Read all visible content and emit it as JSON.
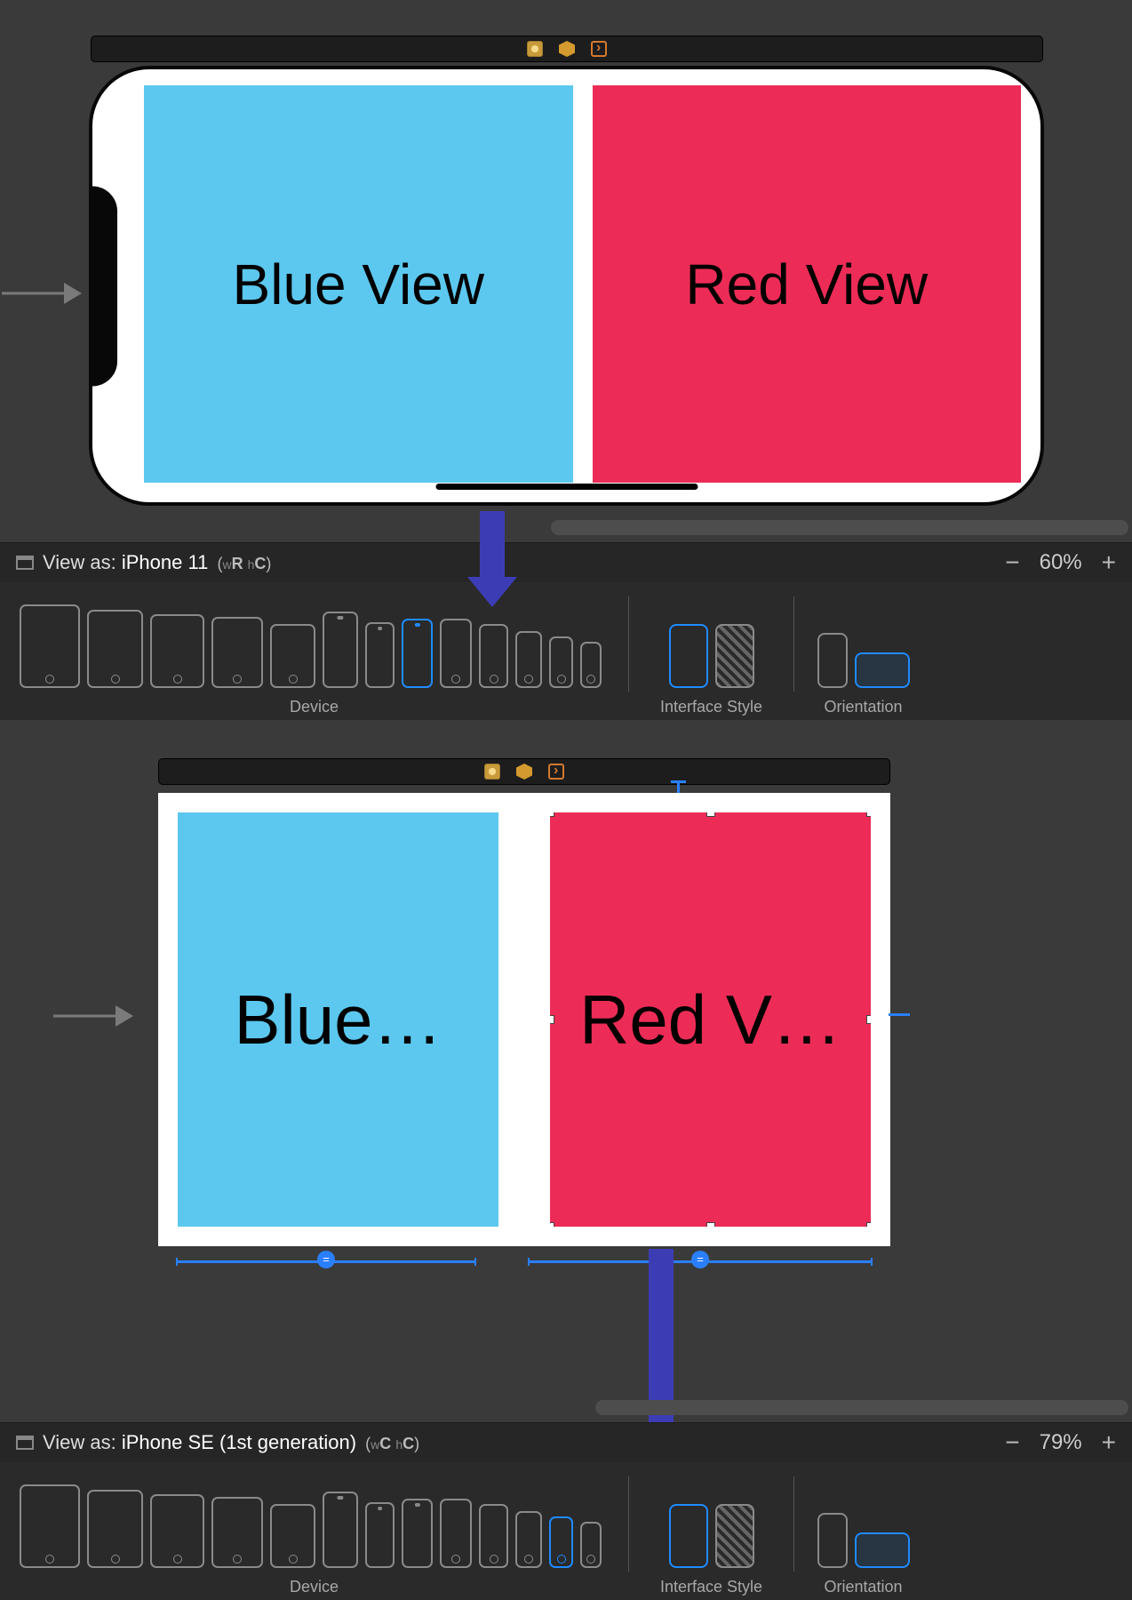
{
  "scene1": {
    "blue_label": "Blue View",
    "red_label": "Red View"
  },
  "scene2": {
    "blue_label": "Blue…",
    "red_label": "Red V…"
  },
  "bar1": {
    "prefix": "View as:",
    "device": "iPhone 11",
    "size_w_prefix": "w",
    "size_w": "R",
    "size_h_prefix": "h",
    "size_h": "C",
    "zoom": "60%",
    "group_device": "Device",
    "group_style": "Interface Style",
    "group_orient": "Orientation"
  },
  "bar2": {
    "prefix": "View as:",
    "device": "iPhone SE (1st generation)",
    "size_w_prefix": "w",
    "size_w": "C",
    "size_h_prefix": "h",
    "size_h": "C",
    "zoom": "79%",
    "group_device": "Device",
    "group_style": "Interface Style",
    "group_orient": "Orientation"
  }
}
